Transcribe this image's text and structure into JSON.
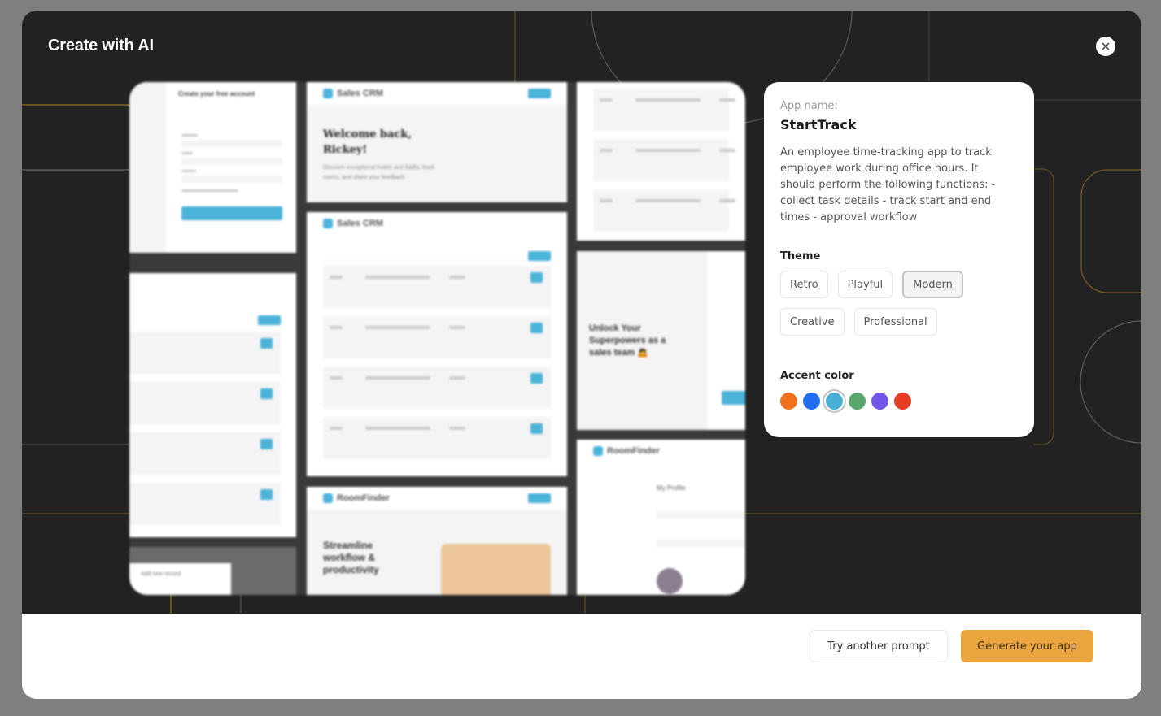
{
  "modal": {
    "title": "Create with AI",
    "close_icon": "close-icon"
  },
  "app": {
    "name_label": "App name:",
    "name": "StartTrack",
    "description": "An employee time-tracking app to track employee work during office hours. It should perform the following functions: - collect task details - track start and end times - approval workflow"
  },
  "theme": {
    "label": "Theme",
    "options": [
      "Retro",
      "Playful",
      "Modern",
      "Creative",
      "Professional"
    ],
    "selected": "Modern"
  },
  "accent": {
    "label": "Accent color",
    "colors": [
      "#f07020",
      "#1f6ff0",
      "#4aafd4",
      "#58a66e",
      "#7256e8",
      "#e43d26"
    ],
    "selected": "#4aafd4"
  },
  "preview": {
    "signup_title": "Create your free account",
    "brand_sales": "Sales CRM",
    "welcome_heading": "Welcome back, Rickey!",
    "welcome_sub": "Discover exceptional hotels and B&Bs, book rooms, and share your feedback",
    "unlock_heading": "Unlock Your Superpowers as a sales team 🙇",
    "brand_room": "RoomFinder",
    "streamline_heading": "Streamline workflow & productivity",
    "profile_title": "My Profile",
    "add_record": "Add new record"
  },
  "footer": {
    "secondary_label": "Try another prompt",
    "primary_label": "Generate your app",
    "primary_color": "#eba640"
  }
}
